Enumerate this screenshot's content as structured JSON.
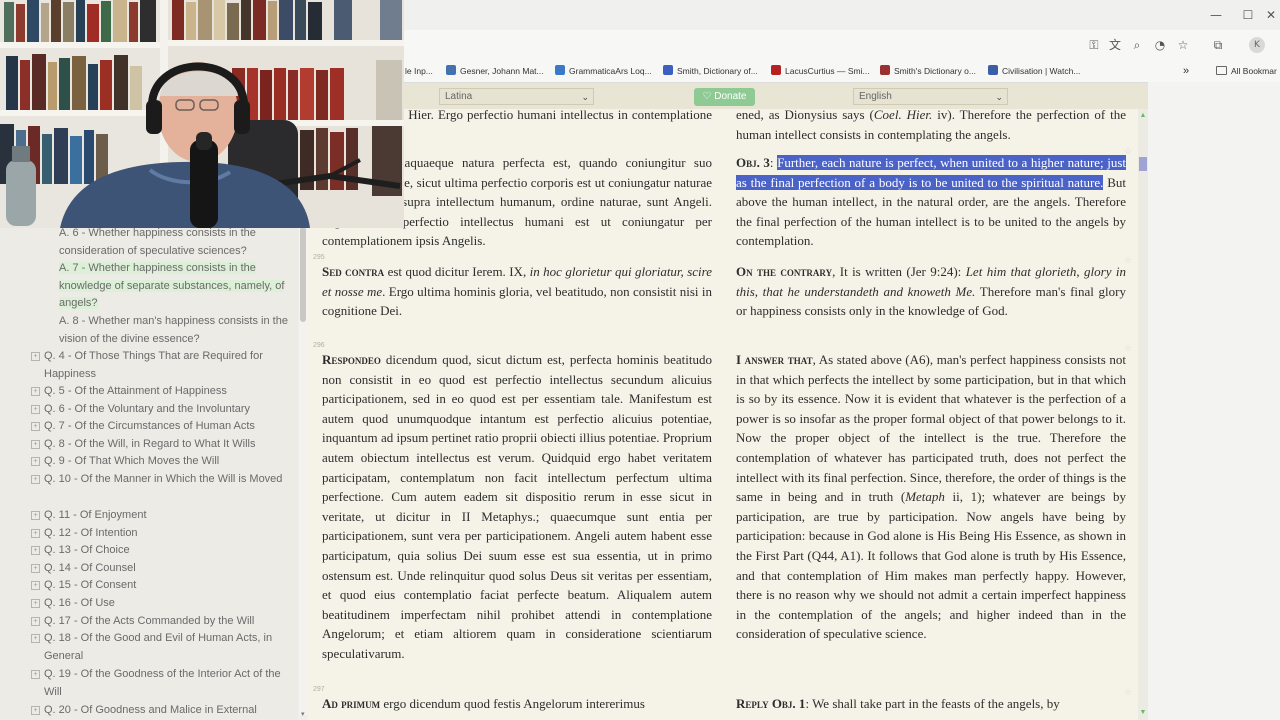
{
  "browser": {
    "window_controls": [
      "—",
      "☐",
      "✕"
    ],
    "bookmarks": [
      {
        "label": "le Inp...",
        "color": "#7a9cc5"
      },
      {
        "label": "Gesner, Johann Mat...",
        "color": "#4472b0"
      },
      {
        "label": "GrammaticaArs Loq...",
        "color": "#3c78c8"
      },
      {
        "label": "Smith, Dictionary of...",
        "color": "#3a60c0"
      },
      {
        "label": "LacusCurtius — Smi...",
        "color": "#b62222"
      },
      {
        "label": "Smith's Dictionary o...",
        "color": "#9a3030"
      },
      {
        "label": "Civilisation | Watch...",
        "color": "#3a5ea8"
      }
    ],
    "all_bookmarks_label": "All Bookmar",
    "icons": [
      "key-icon",
      "translate-icon",
      "zoom-icon",
      "performance-icon",
      "star-icon",
      "extensions-icon",
      "profile-icon"
    ]
  },
  "toolbar": {
    "left_language": "Latina",
    "right_language": "English",
    "donate_label": "Donate"
  },
  "sidebar": {
    "items": [
      {
        "text": "A. 6 - Whether happiness consists in the consideration of speculative sciences?",
        "level": 2
      },
      {
        "text": "A. 7 - Whether happiness consists in the knowledge of separate substances, namely, of angels?",
        "level": 2,
        "highlight": true
      },
      {
        "text": "A. 8 - Whether man's happiness consists in the vision of the divine essence?",
        "level": 2
      },
      {
        "text": "Q. 4 - Of Those Things That are Required for Happiness",
        "level": 1
      },
      {
        "text": "Q. 5 - Of the Attainment of Happiness",
        "level": 1
      },
      {
        "text": "Q. 6 - Of the Voluntary and the Involuntary",
        "level": 1
      },
      {
        "text": "Q. 7 - Of the Circumstances of Human Acts",
        "level": 1
      },
      {
        "text": "Q. 8 - Of the Will, in Regard to What It Wills",
        "level": 1
      },
      {
        "text": "Q. 9 - Of That Which Moves the Will",
        "level": 1
      },
      {
        "text": "Q. 10 - Of the Manner in Which the Will is Moved",
        "level": 1
      },
      {
        "text": "Q. 11 - Of Enjoyment",
        "level": 1
      },
      {
        "text": "Q. 12 - Of Intention",
        "level": 1
      },
      {
        "text": "Q. 13 - Of Choice",
        "level": 1
      },
      {
        "text": "Q. 14 - Of Counsel",
        "level": 1
      },
      {
        "text": "Q. 15 - Of Consent",
        "level": 1
      },
      {
        "text": "Q. 16 - Of Use",
        "level": 1
      },
      {
        "text": "Q. 17 - Of the Acts Commanded by the Will",
        "level": 1
      },
      {
        "text": "Q. 18 - Of the Good and Evil of Human Acts, in General",
        "level": 1
      },
      {
        "text": "Q. 19 - Of the Goodness of the Interior Act of the Will",
        "level": 1
      },
      {
        "text": "Q. 20 - Of Goodness and Malice in External",
        "level": 1
      }
    ]
  },
  "content": {
    "latin": [
      {
        "num": "",
        "html": "s, IV cap. Cael. Hier. Ergo perfectio humani intellectus in contemplatione Angelorum."
      },
      {
        "num": "",
        "html": "<b>Praeterea</b>, unaquaeque natura perfecta est, quando coniungitur suo superiori naturae, sicut ultima perfectio corporis est ut coniungatur naturae spirituali. Sed supra intellectum humanum, ordine naturae, sunt Angeli. Ergo ultima perfectio intellectus humani est ut coniungatur per contemplationem ipsis Angelis."
      },
      {
        "num": "295",
        "html": "<b>Sed contra</b> est quod dicitur Ierem. IX, <i>in hoc glorietur qui gloriatur, scire et nosse me</i>. Ergo ultima hominis gloria, vel beatitudo, non consistit nisi in cognitione Dei."
      },
      {
        "num": "296",
        "html": "<b>Respondeo</b> dicendum quod, sicut dictum est, perfecta hominis beatitudo non consistit in eo quod est perfectio intellectus secundum alicuius participationem, sed in eo quod est per essentiam tale. Manifestum est autem quod unumquodque intantum est perfectio alicuius potentiae, inquantum ad ipsum pertinet ratio proprii obiecti illius potentiae. Proprium autem obiectum intellectus est verum. Quidquid ergo habet veritatem participatam, contemplatum non facit intellectum perfectum ultima perfectione. Cum autem eadem sit dispositio rerum in esse sicut in veritate, ut dicitur in II Metaphys.; quaecumque sunt entia per participationem, sunt vera per participationem. Angeli autem habent esse participatum, quia solius Dei suum esse est sua essentia, ut in primo ostensum est. Unde relinquitur quod solus Deus sit veritas per essentiam, et quod eius contemplatio faciat perfecte beatum. Aliqualem autem beatitudinem imperfectam nihil prohibet attendi in contemplatione Angelorum; et etiam altiorem quam in consideratione scientiarum speculativarum."
      },
      {
        "num": "297",
        "html": "<b>Ad primum</b> ergo dicendum quod festis Angelorum intererimus"
      }
    ],
    "english": [
      {
        "html": "ened, as Dionysius says (<i>Coel. Hier.</i> iv). Therefore the perfection of the human intellect consists in contemplating the angels."
      },
      {
        "html": "<b>Obj. 3</b>: <span class=\"hi\">Further, each nature is perfect, when united to a higher nature; just as the final perfection of a body is to be united to the spiritual nature.</span> But above the human intellect, in the natural order, are the angels. Therefore the final perfection of the human intellect is to be united to the angels by contemplation."
      },
      {
        "html": "<b>On the contrary</b>, It is written (Jer 9:24): <i>Let him that glorieth, glory in this, that he understandeth and knoweth Me.</i> Therefore man's final glory or happiness consists only in the knowledge of God."
      },
      {
        "html": "<b>I answer that</b>, As stated above (A6), man's perfect happiness consists not in that which perfects the intellect by some participation, but in that which is so by its essence. Now it is evident that whatever is the perfection of a power is so insofar as the proper formal object of that power belongs to it. Now the proper object of the intellect is the true. Therefore the contemplation of whatever has participated truth, does not perfect the intellect with its final perfection. Since, therefore, the order of things is the same in being and in truth (<i>Metaph</i> ii, 1); whatever are beings by participation, are true by participation. Now angels have being by participation: because in God alone is His Being His Essence, as shown in the First Part (Q44, A1). It follows that God alone is truth by His Essence, and that contemplation of Him makes man perfectly happy. However, there is no reason why we should not admit a certain imperfect happiness in the contemplation of the angels; and higher indeed than in the consideration of speculative science."
      },
      {
        "html": "<b>Reply Obj. 1</b>: We shall take part in the feasts of the angels, by"
      }
    ]
  },
  "colors": {
    "highlight": "#4b62c7",
    "sidebar_highlight": "#dcefd7",
    "page_background": "#f5f3e8",
    "donate": "#8fca95"
  }
}
